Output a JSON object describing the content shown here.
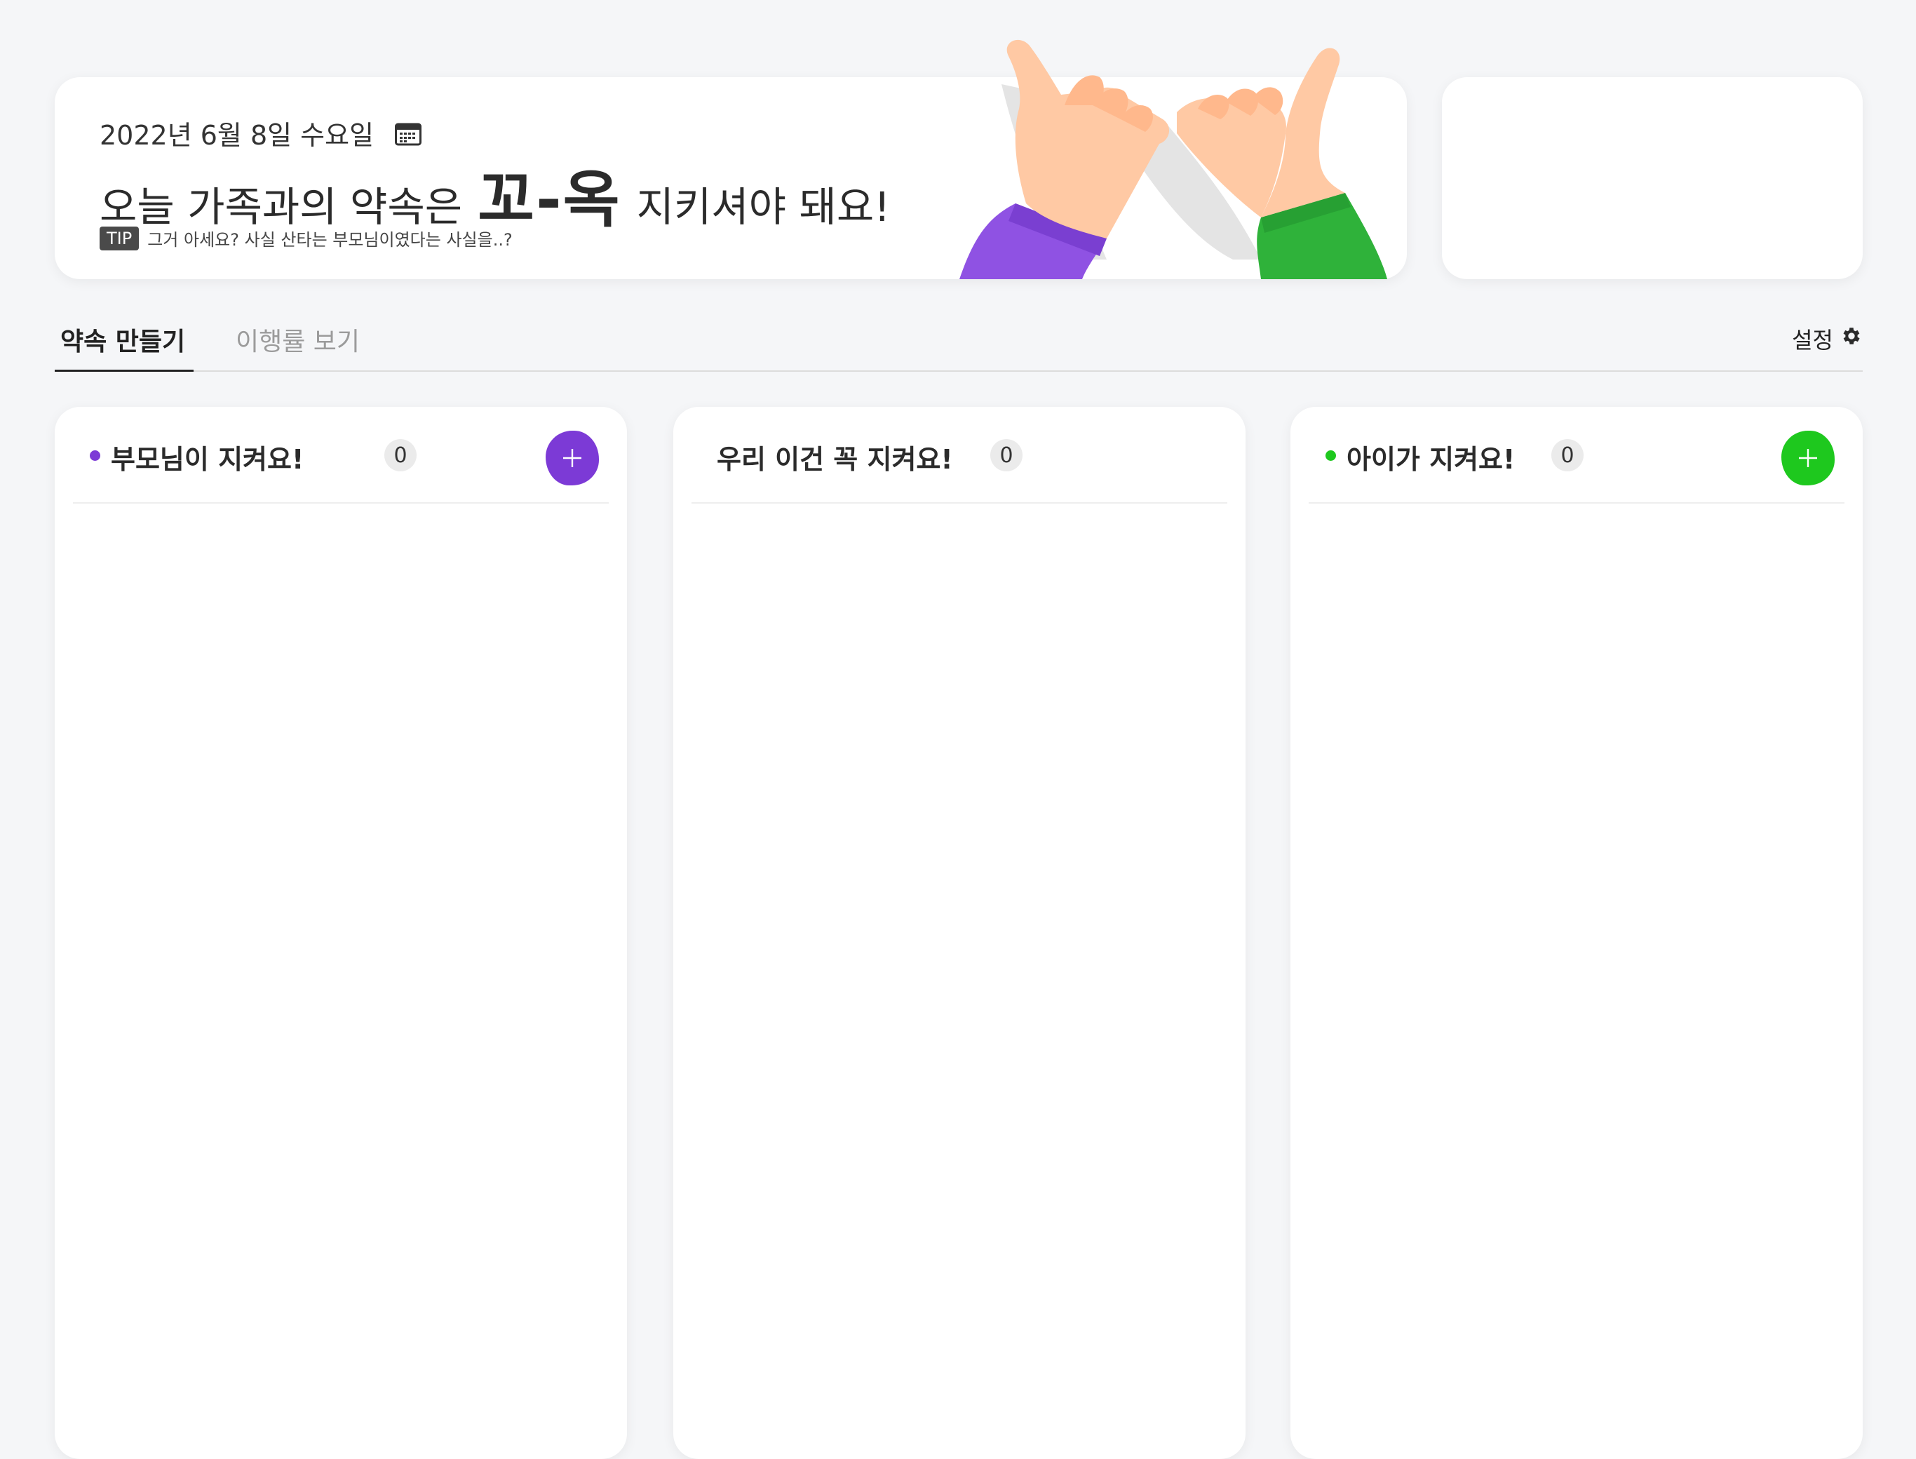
{
  "banner": {
    "date": "2022년 6월 8일 수요일",
    "headline_before": "오늘 가족과의 약속은",
    "headline_emphasis": "꼬-옥",
    "headline_after": "지키셔야 돼요!",
    "tip_label": "TIP",
    "tip_text": "그거 아세요? 사실 산타는 부모님이였다는 사실을..?"
  },
  "tabs": [
    {
      "label": "약속 만들기",
      "active": true
    },
    {
      "label": "이행률 보기",
      "active": false
    }
  ],
  "settings_label": "설정",
  "columns": [
    {
      "title": "부모님이 지켜요!",
      "count": "0",
      "dot_color": "#7c3ad6",
      "button_color": "#7c3ad6"
    },
    {
      "title": "우리 이건 꼭 지켜요!",
      "count": "0"
    },
    {
      "title": "아이가 지켜요!",
      "count": "0",
      "dot_color": "#1ec81e",
      "button_color": "#1ec81e"
    }
  ],
  "colors": {
    "purple": "#7c3ad6",
    "green": "#1ec81e",
    "background": "#f5f6f8"
  }
}
